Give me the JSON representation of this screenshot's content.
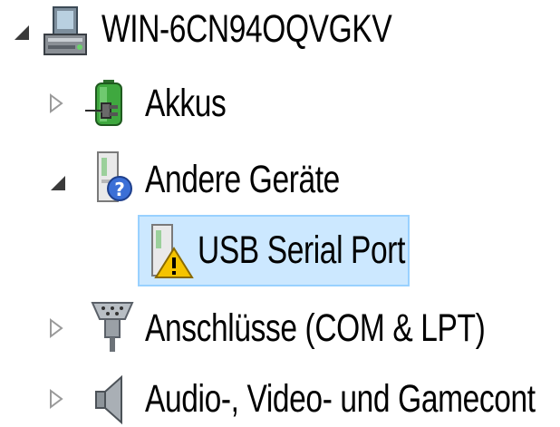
{
  "tree": {
    "root": {
      "label": "WIN-6CN94OQVGKV",
      "expander": "expanded",
      "icon": "computer-icon"
    },
    "items": [
      {
        "label": "Akkus",
        "expander": "collapsed",
        "icon": "battery-icon"
      },
      {
        "label": "Andere Geräte",
        "expander": "expanded",
        "icon": "unknown-device-icon"
      },
      {
        "label": "USB Serial Port",
        "expander": "none",
        "icon": "warning-device-icon",
        "selected": true
      },
      {
        "label": "Anschlüsse (COM & LPT)",
        "expander": "collapsed",
        "icon": "port-icon"
      },
      {
        "label": "Audio-, Video- und Gamecont",
        "expander": "collapsed",
        "icon": "speaker-icon"
      }
    ]
  },
  "colors": {
    "selection_bg": "#cce8ff",
    "selection_border": "#99d1ff",
    "warning": "#f5c400"
  }
}
